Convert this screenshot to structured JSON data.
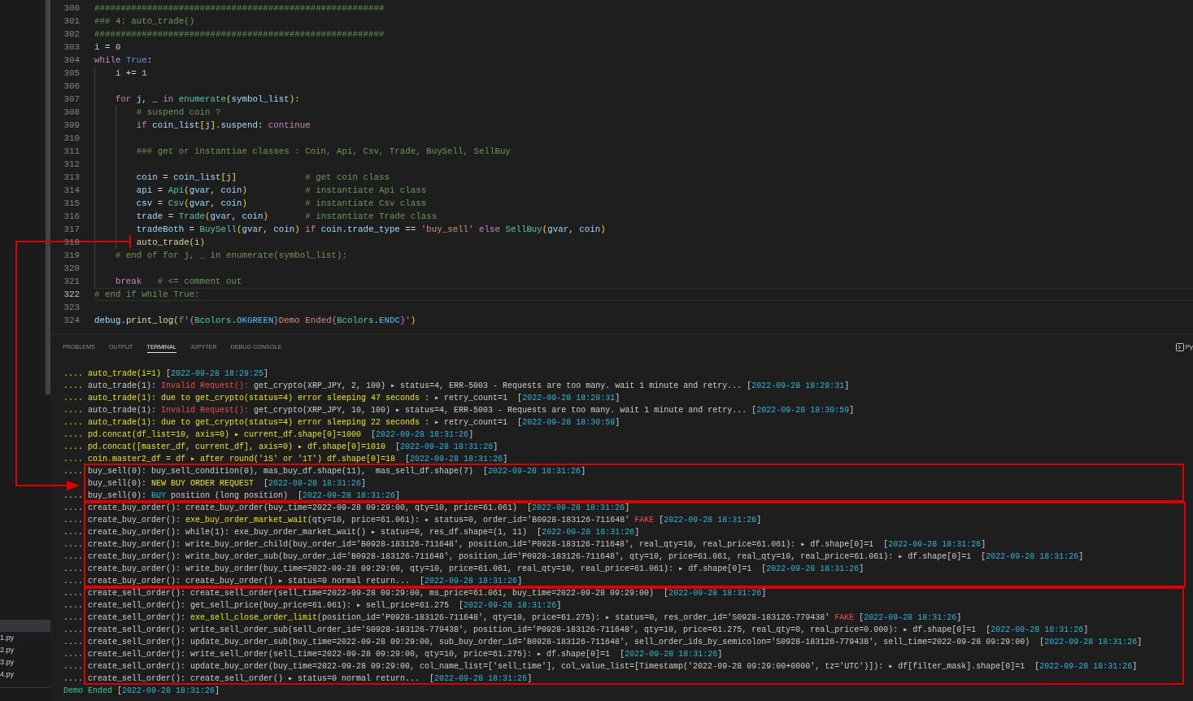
{
  "editor": {
    "lines": [
      {
        "number": "300",
        "active": false,
        "tokens": [
          {
            "text": "#######################################################",
            "kind": "comment"
          }
        ]
      },
      {
        "number": "301",
        "active": false,
        "tokens": [
          {
            "text": "### 4: auto_trade()",
            "kind": "comment"
          }
        ]
      },
      {
        "number": "302",
        "active": false,
        "tokens": [
          {
            "text": "#######################################################",
            "kind": "comment"
          }
        ]
      },
      {
        "number": "303",
        "active": false,
        "tokens": [
          {
            "text": "i",
            "kind": "variable"
          },
          {
            "text": " = ",
            "kind": "operator"
          },
          {
            "text": "0",
            "kind": "number"
          }
        ]
      },
      {
        "number": "304",
        "active": false,
        "tokens": [
          {
            "text": "while",
            "kind": "keyword"
          },
          {
            "text": " True",
            "kind": "constant"
          },
          {
            "text": ":",
            "kind": "operator"
          }
        ],
        "children": [
          {
            "number": "305",
            "active": false,
            "tokens": [
              {
                "text": "i",
                "kind": "variable"
              },
              {
                "text": " += ",
                "kind": "operator"
              },
              {
                "text": "1",
                "kind": "number"
              }
            ]
          },
          {
            "number": "306",
            "active": false
          },
          {
            "number": "307",
            "active": false,
            "tokens": [
              {
                "text": "for",
                "kind": "keyword"
              },
              {
                "text": " j",
                "kind": "variable"
              },
              {
                "text": ", ",
                "kind": "operator"
              },
              {
                "text": "_",
                "kind": "variable"
              },
              {
                "text": " in ",
                "kind": "keyword"
              },
              {
                "text": "enumerate",
                "kind": "class"
              },
              {
                "text": "(",
                "kind": "bracket"
              },
              {
                "text": "symbol_list",
                "kind": "variable"
              },
              {
                "text": ")",
                "kind": "bracket"
              },
              {
                "text": ":",
                "kind": "operator"
              }
            ],
            "children": [
              {
                "number": "308",
                "active": false,
                "tokens": [
                  {
                    "text": "# suspend coin ?",
                    "kind": "comment"
                  }
                ]
              },
              {
                "number": "309",
                "active": false,
                "tokens": [
                  {
                    "text": "if",
                    "kind": "keyword"
                  },
                  {
                    "text": " coin_list",
                    "kind": "variable"
                  },
                  {
                    "text": "[",
                    "kind": "bracket"
                  },
                  {
                    "text": "j",
                    "kind": "variable"
                  },
                  {
                    "text": "]",
                    "kind": "bracket"
                  },
                  {
                    "text": ".suspend",
                    "kind": "variable"
                  },
                  {
                    "text": ": ",
                    "kind": "operator"
                  },
                  {
                    "text": "continue",
                    "kind": "keyword"
                  }
                ]
              },
              {
                "number": "310",
                "active": false
              },
              {
                "number": "311",
                "active": false,
                "tokens": [
                  {
                    "text": "### get or instantiae classes : Coin, Api, Csv, Trade, BuySell, SellBuy",
                    "kind": "comment"
                  }
                ]
              },
              {
                "number": "312",
                "active": false
              },
              {
                "number": "313",
                "active": false,
                "tokens": [
                  {
                    "text": "coin",
                    "kind": "variable"
                  },
                  {
                    "text": " = ",
                    "kind": "operator"
                  },
                  {
                    "text": "coin_list",
                    "kind": "variable"
                  },
                  {
                    "text": "[",
                    "kind": "bracket"
                  },
                  {
                    "text": "j",
                    "kind": "variable"
                  },
                  {
                    "text": "]",
                    "kind": "bracket"
                  },
                  {
                    "text": "             # get coin class",
                    "kind": "comment"
                  }
                ]
              },
              {
                "number": "314",
                "active": false,
                "tokens": [
                  {
                    "text": "api",
                    "kind": "variable"
                  },
                  {
                    "text": " = ",
                    "kind": "operator"
                  },
                  {
                    "text": "Api",
                    "kind": "class"
                  },
                  {
                    "text": "(",
                    "kind": "bracket"
                  },
                  {
                    "text": "gvar",
                    "kind": "variable"
                  },
                  {
                    "text": ", ",
                    "kind": "operator"
                  },
                  {
                    "text": "coin",
                    "kind": "variable"
                  },
                  {
                    "text": ")",
                    "kind": "bracket"
                  },
                  {
                    "text": "           # instantiate Api class",
                    "kind": "comment"
                  }
                ]
              },
              {
                "number": "315",
                "active": false,
                "tokens": [
                  {
                    "text": "csv",
                    "kind": "variable"
                  },
                  {
                    "text": " = ",
                    "kind": "operator"
                  },
                  {
                    "text": "Csv",
                    "kind": "class"
                  },
                  {
                    "text": "(",
                    "kind": "bracket"
                  },
                  {
                    "text": "gvar",
                    "kind": "variable"
                  },
                  {
                    "text": ", ",
                    "kind": "operator"
                  },
                  {
                    "text": "coin",
                    "kind": "variable"
                  },
                  {
                    "text": ")",
                    "kind": "bracket"
                  },
                  {
                    "text": "           # instantiate Csv class",
                    "kind": "comment"
                  }
                ]
              },
              {
                "number": "316",
                "active": false,
                "tokens": [
                  {
                    "text": "trade",
                    "kind": "variable"
                  },
                  {
                    "text": " = ",
                    "kind": "operator"
                  },
                  {
                    "text": "Trade",
                    "kind": "class"
                  },
                  {
                    "text": "(",
                    "kind": "bracket"
                  },
                  {
                    "text": "gvar",
                    "kind": "variable"
                  },
                  {
                    "text": ", ",
                    "kind": "operator"
                  },
                  {
                    "text": "coin",
                    "kind": "variable"
                  },
                  {
                    "text": ")",
                    "kind": "bracket"
                  },
                  {
                    "text": "       # instantiate Trade class",
                    "kind": "comment"
                  }
                ]
              },
              {
                "number": "317",
                "active": false,
                "tokens": [
                  {
                    "text": "tradeBoth",
                    "kind": "variable"
                  },
                  {
                    "text": " = ",
                    "kind": "operator"
                  },
                  {
                    "text": "BuySell",
                    "kind": "class"
                  },
                  {
                    "text": "(",
                    "kind": "bracket"
                  },
                  {
                    "text": "gvar",
                    "kind": "variable"
                  },
                  {
                    "text": ", ",
                    "kind": "operator"
                  },
                  {
                    "text": "coin",
                    "kind": "variable"
                  },
                  {
                    "text": ")",
                    "kind": "bracket"
                  },
                  {
                    "text": " if ",
                    "kind": "keyword"
                  },
                  {
                    "text": "coin.trade_type",
                    "kind": "variable"
                  },
                  {
                    "text": " == ",
                    "kind": "operator"
                  },
                  {
                    "text": "'buy_sell'",
                    "kind": "string"
                  },
                  {
                    "text": " else ",
                    "kind": "keyword"
                  },
                  {
                    "text": "SellBuy",
                    "kind": "class"
                  },
                  {
                    "text": "(",
                    "kind": "bracket"
                  },
                  {
                    "text": "gvar",
                    "kind": "variable"
                  },
                  {
                    "text": ", ",
                    "kind": "operator"
                  },
                  {
                    "text": "coin",
                    "kind": "variable"
                  },
                  {
                    "text": ")",
                    "kind": "bracket"
                  }
                ]
              },
              {
                "number": "318",
                "active": false,
                "tokens": [
                  {
                    "text": "auto_trade",
                    "kind": "function"
                  },
                  {
                    "text": "(",
                    "kind": "bracket"
                  },
                  {
                    "text": "i",
                    "kind": "variable"
                  },
                  {
                    "text": ")",
                    "kind": "bracket"
                  }
                ]
              }
            ]
          },
          {
            "number": "319",
            "active": false,
            "tokens": [
              {
                "text": "# end of for j, _ in enumerate(symbol_list):",
                "kind": "comment"
              }
            ]
          },
          {
            "number": "320",
            "active": false
          },
          {
            "number": "321",
            "active": false,
            "tokens": [
              {
                "text": "break",
                "kind": "keyword"
              },
              {
                "text": "   # <= comment out",
                "kind": "comment"
              }
            ]
          }
        ]
      },
      {
        "number": "322",
        "active": true,
        "tokens": [
          {
            "text": "# end if while True:",
            "kind": "comment"
          }
        ]
      },
      {
        "number": "323",
        "active": false
      },
      {
        "number": "324",
        "active": false,
        "tokens": [
          {
            "text": "debug",
            "kind": "variable"
          },
          {
            "text": ".",
            "kind": "operator"
          },
          {
            "text": "print_log",
            "kind": "function"
          },
          {
            "text": "(",
            "kind": "bracket"
          },
          {
            "text": "f",
            "kind": "constant"
          },
          {
            "text": "'",
            "kind": "string"
          },
          {
            "text": "{",
            "kind": "brace"
          },
          {
            "text": "Bcolors",
            "kind": "class"
          },
          {
            "text": ".",
            "kind": "operator"
          },
          {
            "text": "OKGREEN",
            "kind": "member"
          },
          {
            "text": "}",
            "kind": "brace"
          },
          {
            "text": "Demo Ended",
            "kind": "string"
          },
          {
            "text": "{",
            "kind": "brace"
          },
          {
            "text": "Bcolors",
            "kind": "class"
          },
          {
            "text": ".",
            "kind": "operator"
          },
          {
            "text": "ENDC",
            "kind": "member"
          },
          {
            "text": "}",
            "kind": "brace"
          },
          {
            "text": "'",
            "kind": "string"
          },
          {
            "text": ")",
            "kind": "bracket"
          }
        ]
      }
    ]
  },
  "panel": {
    "tabs": [
      {
        "label": "PROBLEMS",
        "selected": false
      },
      {
        "label": "OUTPUT",
        "selected": false
      },
      {
        "label": "TERMINAL",
        "selected": true
      },
      {
        "label": "JUPYTER",
        "selected": false
      },
      {
        "label": "DEBUG CONSOLE",
        "selected": false
      }
    ],
    "terminal_button": {
      "label": "Py"
    }
  },
  "terminal": {
    "lines": [
      {
        "kind": "log",
        "prefix": {
          "text": "....",
          "kind": "yellow"
        },
        "segments": [
          {
            "text": "auto_trade(i=1)",
            "kind": "yellow"
          },
          {
            "text": " [",
            "kind": "plain"
          },
          {
            "text": "2022-09-28 18:29:25",
            "kind": "cyan"
          },
          {
            "text": "]",
            "kind": "plain"
          }
        ]
      },
      {
        "kind": "log",
        "prefix": {
          "text": "....",
          "kind": "yellow"
        },
        "segments": [
          {
            "text": "auto_trade(1): ",
            "kind": "plain"
          },
          {
            "text": "Invalid Request():",
            "kind": "red"
          },
          {
            "text": " get_crypto(XRP_JPY, 2, 100) ▸ status=4, ERR-5003 - Requests are too many. wait 1 minute and retry... [",
            "kind": "plain"
          },
          {
            "text": "2022-09-28 18:29:31",
            "kind": "cyan"
          },
          {
            "text": "]",
            "kind": "plain"
          }
        ]
      },
      {
        "kind": "log",
        "prefix": {
          "text": "....",
          "kind": "yellow"
        },
        "segments": [
          {
            "text": "auto_trade(1): due to get_crypto(status=4) error sleeping 47 seconds :",
            "kind": "yellow"
          },
          {
            "text": " ▸ retry_count=1  [",
            "kind": "plain"
          },
          {
            "text": "2022-09-28 18:29:31",
            "kind": "cyan"
          },
          {
            "text": "]",
            "kind": "plain"
          }
        ]
      },
      {
        "kind": "log",
        "prefix": {
          "text": "....",
          "kind": "yellow"
        },
        "segments": [
          {
            "text": "auto_trade(1): ",
            "kind": "plain"
          },
          {
            "text": "Invalid Request():",
            "kind": "red"
          },
          {
            "text": " get_crypto(XRP_JPY, 10, 100) ▸ status=4, ERR-5003 - Requests are too many. wait 1 minute and retry... [",
            "kind": "plain"
          },
          {
            "text": "2022-09-28 18:30:59",
            "kind": "cyan"
          },
          {
            "text": "]",
            "kind": "plain"
          }
        ]
      },
      {
        "kind": "log",
        "prefix": {
          "text": "....",
          "kind": "yellow"
        },
        "segments": [
          {
            "text": "auto_trade(1): due to get_crypto(status=4) error sleeping 22 seconds :",
            "kind": "yellow"
          },
          {
            "text": " ▸ retry_count=1  [",
            "kind": "plain"
          },
          {
            "text": "2022-09-28 18:30:59",
            "kind": "cyan"
          },
          {
            "text": "]",
            "kind": "plain"
          }
        ]
      },
      {
        "kind": "log",
        "prefix": {
          "text": "....",
          "kind": "yellow"
        },
        "segments": [
          {
            "text": "pd.concat(df_list=10, axis=0) ▸ current_df.shape[0]=1000",
            "kind": "yellow"
          },
          {
            "text": "  [",
            "kind": "plain"
          },
          {
            "text": "2022-09-28 18:31:26",
            "kind": "cyan"
          },
          {
            "text": "]",
            "kind": "plain"
          }
        ]
      },
      {
        "kind": "log",
        "prefix": {
          "text": "....",
          "kind": "yellow"
        },
        "segments": [
          {
            "text": "pd.concat([master_df, current_df], axis=0) ▸ df.shape[0]=1010",
            "kind": "yellow"
          },
          {
            "text": "  [",
            "kind": "plain"
          },
          {
            "text": "2022-09-28 18:31:26",
            "kind": "cyan"
          },
          {
            "text": "]",
            "kind": "plain"
          }
        ]
      },
      {
        "kind": "log",
        "prefix": {
          "text": "....",
          "kind": "yellow"
        },
        "segments": [
          {
            "text": "coin.master2_df = df ▸ after round('1S' or '1T') df.shape[0]=18",
            "kind": "yellow"
          },
          {
            "text": "  [",
            "kind": "plain"
          },
          {
            "text": "2022-09-28 18:31:26",
            "kind": "cyan"
          },
          {
            "text": "]",
            "kind": "plain"
          }
        ]
      },
      {
        "kind": "log",
        "prefix": {
          "text": "....",
          "kind": "plain"
        },
        "segments": [
          {
            "text": "buy_sell(0): buy_sell_condition(0), mas_buy_df.shape(11),  mas_sell_df.shape(7)  [",
            "kind": "plain"
          },
          {
            "text": "2022-09-28 18:31:26",
            "kind": "cyan"
          },
          {
            "text": "]",
            "kind": "plain"
          }
        ]
      },
      {
        "kind": "log",
        "segments": [
          {
            "text": "buy_sell(0): ",
            "kind": "plain"
          },
          {
            "text": "NEW BUY ORDER REQUEST",
            "kind": "yellow"
          },
          {
            "text": "  [",
            "kind": "plain"
          },
          {
            "text": "2022-09-28 18:31:26",
            "kind": "cyan"
          },
          {
            "text": "]",
            "kind": "plain"
          }
        ]
      },
      {
        "kind": "log",
        "prefix": {
          "text": "....",
          "kind": "plain"
        },
        "segments": [
          {
            "text": "buy_sell(0): ",
            "kind": "plain"
          },
          {
            "text": "BUY",
            "kind": "cyan"
          },
          {
            "text": " position (long position)  [",
            "kind": "plain"
          },
          {
            "text": "2022-09-28 18:31:26",
            "kind": "cyan"
          },
          {
            "text": "]",
            "kind": "plain"
          }
        ]
      },
      {
        "kind": "log",
        "prefix": {
          "text": "....",
          "kind": "plain"
        },
        "segments": [
          {
            "text": "create_buy_order(): create_buy_order(buy_time=2022-09-28 09:29:00, qty=10, price=61.061)  [",
            "kind": "plain"
          },
          {
            "text": "2022-09-28 18:31:26",
            "kind": "cyan"
          },
          {
            "text": "]",
            "kind": "plain"
          }
        ]
      },
      {
        "kind": "log",
        "prefix": {
          "text": "....",
          "kind": "plain"
        },
        "segments": [
          {
            "text": "create_buy_order(): ",
            "kind": "plain"
          },
          {
            "text": "exe_buy_order_market_wait",
            "kind": "yellow"
          },
          {
            "text": "(qty=10, price=61.061): ▸ status=0, order_id='B0928-183126-711648' ",
            "kind": "plain"
          },
          {
            "text": "FAKE",
            "kind": "red"
          },
          {
            "text": " [",
            "kind": "plain"
          },
          {
            "text": "2022-09-28 18:31:26",
            "kind": "cyan"
          },
          {
            "text": "]",
            "kind": "plain"
          }
        ]
      },
      {
        "kind": "log",
        "prefix": {
          "text": "....",
          "kind": "plain"
        },
        "segments": [
          {
            "text": "create_buy_order(): while(1): exe_buy_order_market_wait() ▸ status=0, res_df.shape=(1, 11)  [",
            "kind": "plain"
          },
          {
            "text": "2022-09-28 18:31:26",
            "kind": "cyan"
          },
          {
            "text": "]",
            "kind": "plain"
          }
        ]
      },
      {
        "kind": "log",
        "prefix": {
          "text": "....",
          "kind": "plain"
        },
        "segments": [
          {
            "text": "create_buy_order(): write_buy_order_child(buy_order_id='B0928-183126-711648', position_id='P0928-183126-711648', real_qty=10, real_price=61.061): ▸ df.shape[0]=1  [",
            "kind": "plain"
          },
          {
            "text": "2022-09-28 18:31:26",
            "kind": "cyan"
          },
          {
            "text": "]",
            "kind": "plain"
          }
        ]
      },
      {
        "kind": "log",
        "prefix": {
          "text": "....",
          "kind": "plain"
        },
        "segments": [
          {
            "text": "create_buy_order(): write_buy_order_sub(buy_order_id='B0928-183126-711648', position_id='P0928-183126-711648', qty=10, price=61.061, real_qty=10, real_price=61.061): ▸ df.shape[0]=1  [",
            "kind": "plain"
          },
          {
            "text": "2022-09-28 18:31:26",
            "kind": "cyan"
          },
          {
            "text": "]",
            "kind": "plain"
          }
        ]
      },
      {
        "kind": "log",
        "prefix": {
          "text": "....",
          "kind": "plain"
        },
        "segments": [
          {
            "text": "create_buy_order(): write_buy_order(buy_time=2022-09-28 09:29:00, qty=10, price=61.061, real_qty=10, real_price=61.061): ▸ df.shape[0]=1  [",
            "kind": "plain"
          },
          {
            "text": "2022-09-28 18:31:26",
            "kind": "cyan"
          },
          {
            "text": "]",
            "kind": "plain"
          }
        ]
      },
      {
        "kind": "log",
        "prefix": {
          "text": "....",
          "kind": "plain"
        },
        "segments": [
          {
            "text": "create_buy_order(): create_buy_order() ▸ status=0 normal return...  [",
            "kind": "plain"
          },
          {
            "text": "2022-09-28 18:31:26",
            "kind": "cyan"
          },
          {
            "text": "]",
            "kind": "plain"
          }
        ]
      },
      {
        "kind": "log",
        "prefix": {
          "text": "....",
          "kind": "plain"
        },
        "segments": [
          {
            "text": "create_sell_order(): create_sell_order(sell_time=2022-09-28 09:29:00, ms_price=61.061, buy_time=2022-09-28 09:29:00)  [",
            "kind": "plain"
          },
          {
            "text": "2022-09-28 18:31:26",
            "kind": "cyan"
          },
          {
            "text": "]",
            "kind": "plain"
          }
        ]
      },
      {
        "kind": "log",
        "prefix": {
          "text": "....",
          "kind": "plain"
        },
        "segments": [
          {
            "text": "create_sell_order(): get_sell_price(buy_price=61.061): ▸ sell_price=61.275  [",
            "kind": "plain"
          },
          {
            "text": "2022-09-28 18:31:26",
            "kind": "cyan"
          },
          {
            "text": "]",
            "kind": "plain"
          }
        ]
      },
      {
        "kind": "log",
        "prefix": {
          "text": "....",
          "kind": "plain"
        },
        "segments": [
          {
            "text": "create_sell_order(): ",
            "kind": "plain"
          },
          {
            "text": "exe_sell_close_order_limit",
            "kind": "yellow"
          },
          {
            "text": "(position_id='P0928-183126-711648', qty=10, price=61.275): ▸ status=0, res_order_id='S0928-183126-779438' ",
            "kind": "plain"
          },
          {
            "text": "FAKE",
            "kind": "red"
          },
          {
            "text": " [",
            "kind": "plain"
          },
          {
            "text": "2022-09-28 18:31:26",
            "kind": "cyan"
          },
          {
            "text": "]",
            "kind": "plain"
          }
        ]
      },
      {
        "kind": "log",
        "prefix": {
          "text": "....",
          "kind": "plain"
        },
        "segments": [
          {
            "text": "create_sell_order(): write_sell_order_sub(sell_order_id='S0928-183126-779438', position_id='P0928-183126-711648', qty=10, price=61.275, real_qty=0, real_price=0.000): ▸ df.shape[0]=1  [",
            "kind": "plain"
          },
          {
            "text": "2022-09-28 18:31:26",
            "kind": "cyan"
          },
          {
            "text": "]",
            "kind": "plain"
          }
        ]
      },
      {
        "kind": "log",
        "prefix": {
          "text": "....",
          "kind": "plain"
        },
        "segments": [
          {
            "text": "create_sell_order(): update_buy_order_sub(buy_time=2022-09-28 09:29:00, sub_buy_order_id='B0928-183126-711648', sell_order_ids_by_semicolon='S0928-183126-779438', sell_time=2022-09-28 09:29:00)  [",
            "kind": "plain"
          },
          {
            "text": "2022-09-28 18:31:26",
            "kind": "cyan"
          },
          {
            "text": "]",
            "kind": "plain"
          }
        ]
      },
      {
        "kind": "log",
        "prefix": {
          "text": "....",
          "kind": "plain"
        },
        "segments": [
          {
            "text": "create_sell_order(): write_sell_order(sell_time=2022-09-28 09:29:00, qty=10, price=61.275): ▸ df.shape[0]=1  [",
            "kind": "plain"
          },
          {
            "text": "2022-09-28 18:31:26",
            "kind": "cyan"
          },
          {
            "text": "]",
            "kind": "plain"
          }
        ]
      },
      {
        "kind": "log",
        "prefix": {
          "text": "....",
          "kind": "plain"
        },
        "segments": [
          {
            "text": "create_sell_order(): update_buy_order(buy_time=2022-09-28 09:29:00, col_name_list=['sell_time'], col_value_list=[Timestamp('2022-09-28 09:29:00+0000', tz='UTC')]): ▸ df[filter_mask].shape[0]=1  [",
            "kind": "plain"
          },
          {
            "text": "2022-09-28 18:31:26",
            "kind": "cyan"
          },
          {
            "text": "]",
            "kind": "plain"
          }
        ]
      },
      {
        "kind": "log",
        "prefix": {
          "text": "....",
          "kind": "plain"
        },
        "segments": [
          {
            "text": "create_sell_order(): create_sell_order() ▸ status=0 normal return...  [",
            "kind": "plain"
          },
          {
            "text": "2022-09-28 18:31:26",
            "kind": "cyan"
          },
          {
            "text": "]",
            "kind": "plain"
          }
        ]
      },
      {
        "kind": "message",
        "segments": [
          {
            "text": "Demo Ended",
            "kind": "green"
          },
          {
            "text": " [",
            "kind": "plain"
          },
          {
            "text": "2022-09-28 18:31:26",
            "kind": "cyan"
          },
          {
            "text": "]",
            "kind": "plain"
          }
        ]
      }
    ]
  },
  "sidebar": {
    "items": [
      {
        "selected": true
      },
      {
        "label": "1.py",
        "selected": false
      },
      {
        "label": "2.py",
        "selected": false
      },
      {
        "label": "3.py",
        "selected": false
      },
      {
        "label": "4.py",
        "selected": false
      }
    ]
  }
}
